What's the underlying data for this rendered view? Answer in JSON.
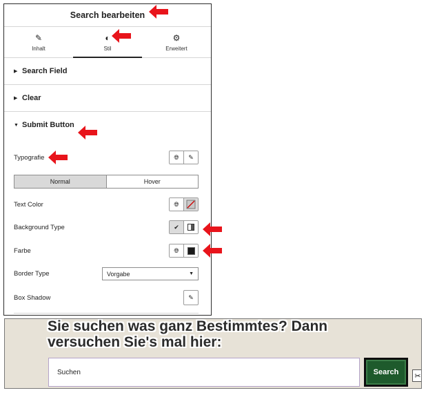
{
  "panel": {
    "title": "Search bearbeiten",
    "tabs": [
      {
        "label": "Inhalt",
        "icon": "pencil-icon"
      },
      {
        "label": "Stil",
        "icon": "contrast-icon",
        "active": true
      },
      {
        "label": "Erweitert",
        "icon": "gear-icon"
      }
    ],
    "sections": {
      "search_field": "Search Field",
      "clear": "Clear",
      "submit_button": "Submit Button"
    },
    "controls": {
      "typografie": "Typografie",
      "state_tabs": [
        "Normal",
        "Hover"
      ],
      "text_color": "Text Color",
      "background_type": "Background Type",
      "farbe": "Farbe",
      "border_type": "Border Type",
      "border_type_value": "Vorgabe",
      "box_shadow": "Box Shadow"
    }
  },
  "preview": {
    "headline_line1": "Sie suchen was ganz Bestimmtes? Dann",
    "headline_line2": "versuchen Sie's mal hier:",
    "input_placeholder": "Suchen",
    "button_label": "Search"
  },
  "colors": {
    "annotation_arrow": "#e8141b",
    "search_button_bg": "#1e5a2c",
    "preview_bg": "#e7e2d7"
  }
}
